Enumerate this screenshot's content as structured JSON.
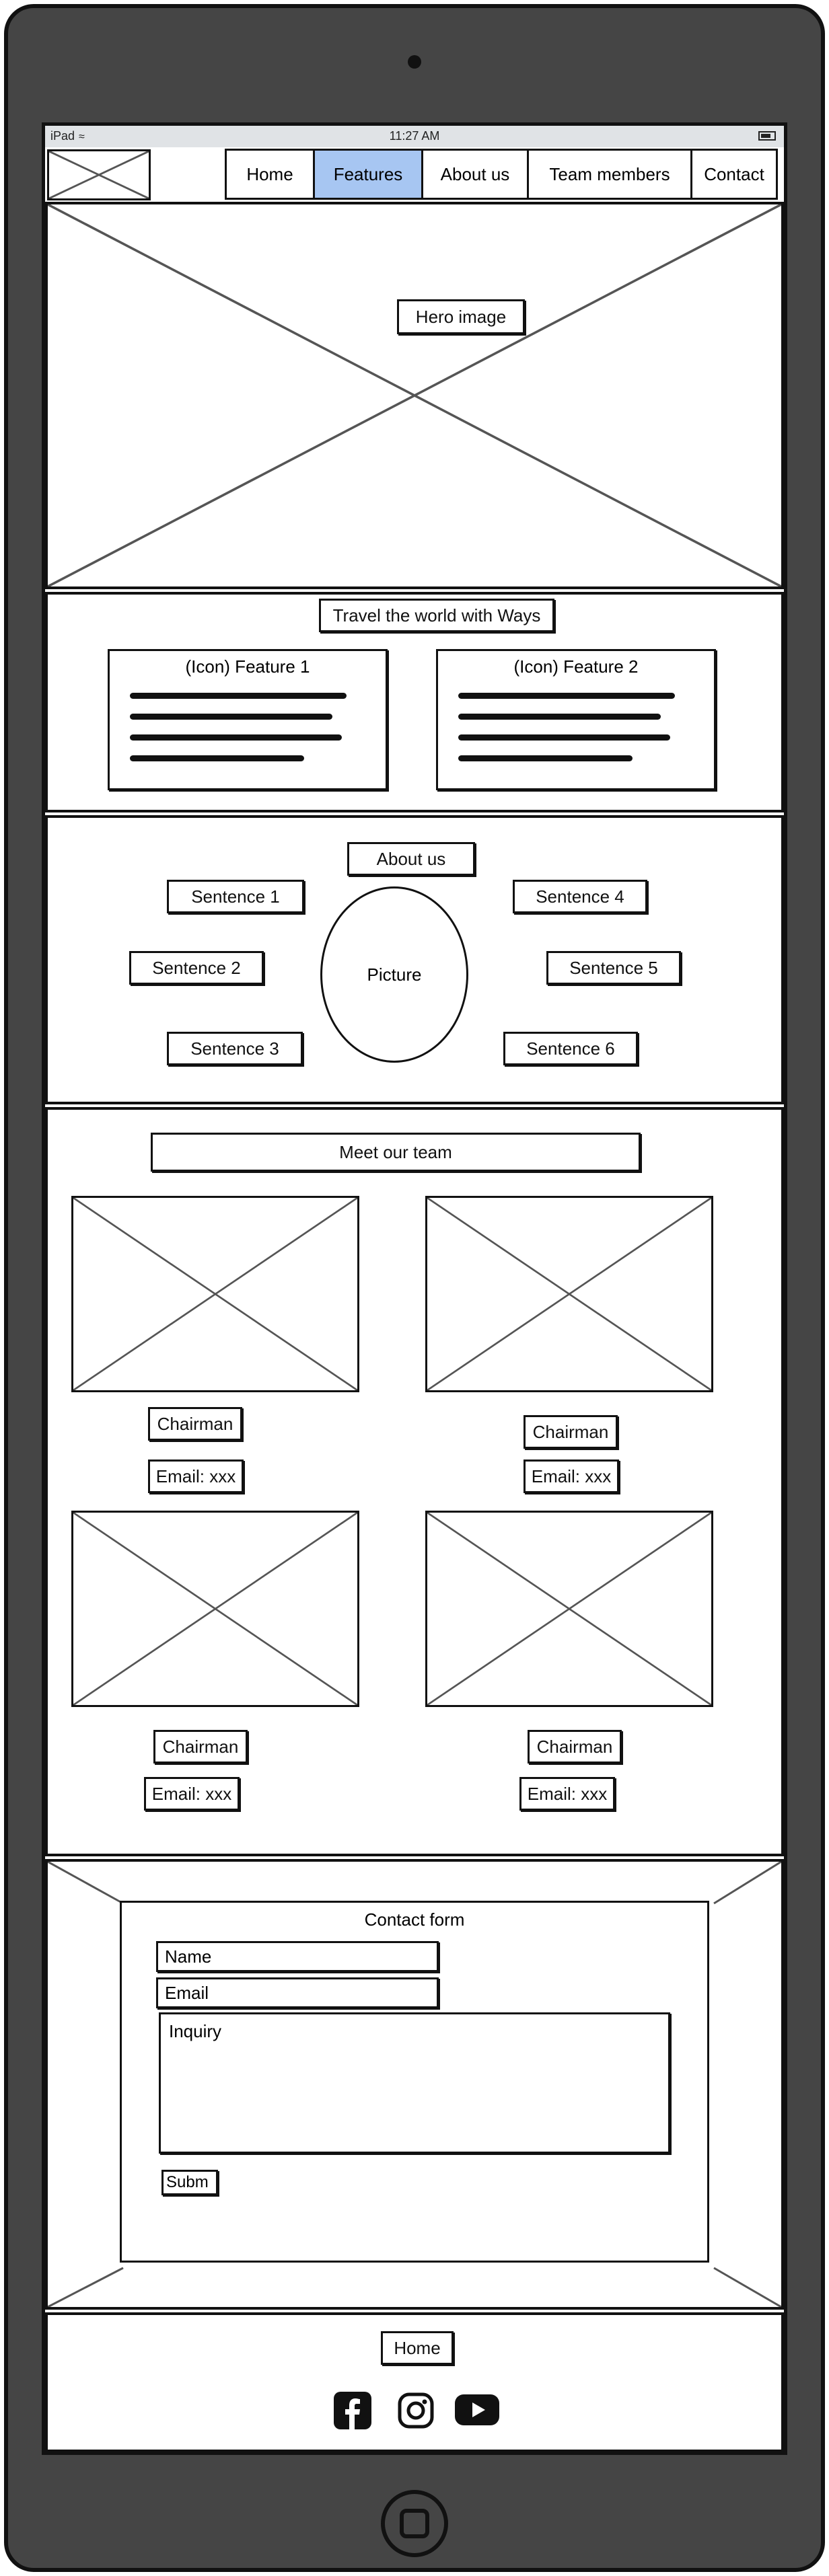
{
  "status_bar": {
    "device": "iPad",
    "time": "11:27 AM"
  },
  "nav": {
    "items": [
      {
        "label": "Home"
      },
      {
        "label": "Features"
      },
      {
        "label": "About us"
      },
      {
        "label": "Team members"
      },
      {
        "label": "Contact"
      }
    ],
    "active": "Features"
  },
  "hero": {
    "label": "Hero image"
  },
  "features": {
    "heading": "Travel the world with Ways",
    "cards": [
      {
        "title": "(Icon) Feature 1"
      },
      {
        "title": "(Icon) Feature 2"
      }
    ]
  },
  "about": {
    "heading": "About us",
    "picture": "Picture",
    "sentences": [
      "Sentence 1",
      "Sentence 2",
      "Sentence 3",
      "Sentence 4",
      "Sentence 5",
      "Sentence 6"
    ]
  },
  "team": {
    "heading": "Meet our team",
    "members": [
      {
        "role": "Chairman",
        "email": "Email: xxx"
      },
      {
        "role": "Chairman",
        "email": "Email: xxx"
      },
      {
        "role": "Chairman",
        "email": "Email: xxx"
      },
      {
        "role": "Chairman",
        "email": "Email: xxx"
      }
    ]
  },
  "contact": {
    "title": "Contact form",
    "name_label": "Name",
    "email_label": "Email",
    "inquiry_label": "Inquiry",
    "submit_label": "Subm"
  },
  "footer": {
    "home_label": "Home",
    "social": [
      "facebook-icon",
      "instagram-icon",
      "youtube-icon"
    ]
  },
  "colors": {
    "active_nav": "#a7c6f2",
    "device": "#454545"
  }
}
